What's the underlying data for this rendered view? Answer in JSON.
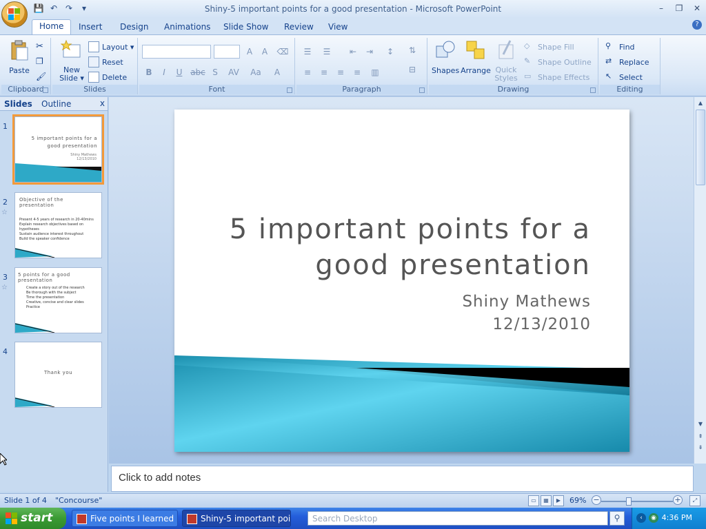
{
  "window": {
    "title": "Shiny-5 important points for a good presentation - Microsoft PowerPoint",
    "min": "–",
    "restore": "❐",
    "close": "✕"
  },
  "qat": {
    "save": "💾",
    "undo": "↶",
    "redo": "↷",
    "more": "▾"
  },
  "tabs": [
    {
      "label": "Home"
    },
    {
      "label": "Insert"
    },
    {
      "label": "Design"
    },
    {
      "label": "Animations"
    },
    {
      "label": "Slide Show"
    },
    {
      "label": "Review"
    },
    {
      "label": "View"
    }
  ],
  "help": "?",
  "ribbon": {
    "clipboard": {
      "label": "Clipboard",
      "paste": "Paste"
    },
    "slides": {
      "label": "Slides",
      "new_slide": "New\nSlide ▾",
      "layout": "Layout ▾",
      "reset": "Reset",
      "delete": "Delete"
    },
    "font": {
      "label": "Font",
      "buttons": [
        "B",
        "I",
        "U",
        "abc",
        "S",
        "AV",
        "Aa",
        "A"
      ]
    },
    "paragraph": {
      "label": "Paragraph"
    },
    "drawing": {
      "label": "Drawing",
      "shapes": "Shapes",
      "arrange": "Arrange",
      "quick_styles": "Quick\nStyles",
      "shape_fill": "Shape Fill",
      "shape_outline": "Shape Outline",
      "shape_effects": "Shape Effects"
    },
    "editing": {
      "label": "Editing",
      "find": "Find",
      "replace": "Replace",
      "select": "Select"
    }
  },
  "pane": {
    "tab_slides": "Slides",
    "tab_outline": "Outline",
    "close": "x",
    "thumbs": [
      {
        "num": "1",
        "title": "5 important points for a good presentation",
        "sub": "Shiny Mathews",
        "date": "12/13/2010"
      },
      {
        "num": "2",
        "title": "Objective of the presentation",
        "bullets": [
          "Present 4-5 years of research in 20-40mins",
          "Explain research objectives based on hypotheses",
          "Sustain audience interest throughout",
          "Build the speaker confidence"
        ]
      },
      {
        "num": "3",
        "title": "5 points for a good presentation",
        "bullets": [
          "Create a story out of the research",
          "Be thorough with the subject",
          "Time the presentation",
          "Creative, concise and clear slides",
          "Practice"
        ]
      },
      {
        "num": "4",
        "title": "Thank you"
      }
    ]
  },
  "slide": {
    "title": "5 important points for a good presentation",
    "subtitle": "Shiny Mathews",
    "date": "12/13/2010"
  },
  "notes": {
    "placeholder": "Click to add notes"
  },
  "status": {
    "slide_of": "Slide 1 of 4",
    "theme": "\"Concourse\"",
    "zoom": "69%"
  },
  "taskbar": {
    "start": "start",
    "task1": "Five points I learned ...",
    "task2": "Shiny-5 important poi...",
    "search_placeholder": "Search Desktop",
    "clock": "4:36 PM"
  }
}
